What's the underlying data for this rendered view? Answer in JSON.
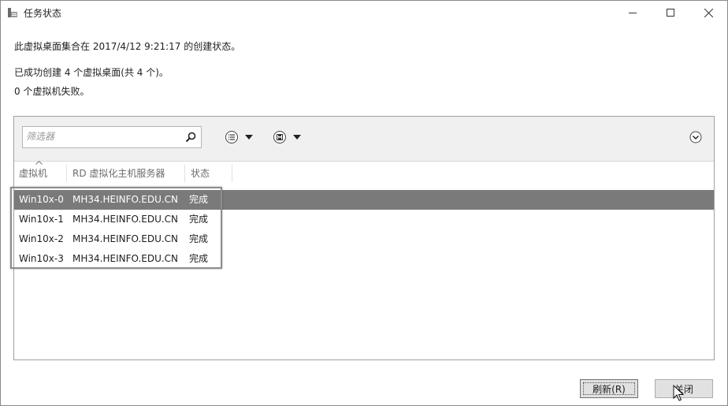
{
  "window": {
    "title": "任务状态",
    "icon": "task-status-icon",
    "controls": {
      "minimize": "minimize-icon",
      "maximize": "maximize-icon",
      "close": "close-icon"
    }
  },
  "messages": {
    "line1": "此虚拟桌面集合在 2017/4/12 9:21:17 的创建状态。",
    "line2": "已成功创建 4 个虚拟桌面(共 4 个)。",
    "line3": "0 个虚拟机失败。"
  },
  "toolbar": {
    "filter_placeholder": "筛选器",
    "search_icon": "search-icon",
    "list_icon": "list-options-icon",
    "save_icon": "save-query-icon",
    "dropdown_icon": "dropdown-arrow-icon",
    "expand_icon": "expand-circle-icon"
  },
  "table": {
    "columns": [
      "虚拟机",
      "RD 虚拟化主机服务器",
      "状态"
    ],
    "rows": [
      {
        "vm": "Win10x-0",
        "host": "MH34.HEINFO.EDU.CN",
        "status": "完成",
        "selected": true
      },
      {
        "vm": "Win10x-1",
        "host": "MH34.HEINFO.EDU.CN",
        "status": "完成",
        "selected": false
      },
      {
        "vm": "Win10x-2",
        "host": "MH34.HEINFO.EDU.CN",
        "status": "完成",
        "selected": false
      },
      {
        "vm": "Win10x-3",
        "host": "MH34.HEINFO.EDU.CN",
        "status": "完成",
        "selected": false
      }
    ]
  },
  "buttons": {
    "refresh": "刷新(R)",
    "close": "关闭"
  },
  "colors": {
    "selected_row": "#7a7a7a",
    "toolbar_bg": "#f0f0f0",
    "button_bg": "#e1e1e1"
  }
}
